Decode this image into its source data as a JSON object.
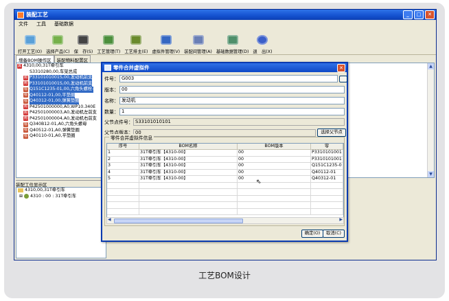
{
  "window": {
    "title": "装配工艺"
  },
  "menu": [
    "文件",
    "工具",
    "基础数据"
  ],
  "toolbar": [
    {
      "label": "打开工艺(O)",
      "icon": "open-process-icon"
    },
    {
      "label": "选择产品(C)",
      "icon": "select-product-icon"
    },
    {
      "label": "保　存(S)",
      "icon": "save-icon"
    },
    {
      "label": "工艺管理(T)",
      "icon": "process-manage-icon"
    },
    {
      "label": "工艺排主(E)",
      "icon": "process-sort-icon"
    },
    {
      "label": "虚拟件管理(V)",
      "icon": "virtual-part-icon"
    },
    {
      "label": "装配间管理(A)",
      "icon": "assembly-room-icon"
    },
    {
      "label": "基础数据管理(D)",
      "icon": "base-data-icon"
    },
    {
      "label": "退　出(X)",
      "icon": "exit-icon"
    }
  ],
  "left_tabs": [
    "增备BOM操作区",
    "装配物料配置区"
  ],
  "tree": [
    {
      "badge": "其",
      "text": "4310,00,31T牵引车",
      "selected": false,
      "indent": 0
    },
    {
      "badge": "",
      "text": "S3310280,00,车架总成",
      "selected": false,
      "indent": 1
    },
    {
      "badge": "购",
      "text": "P3310101001S,00,发动机前支",
      "selected": true,
      "indent": 1
    },
    {
      "badge": "购",
      "text": "P3310101001S,00,发动机前支",
      "selected": true,
      "indent": 1
    },
    {
      "badge": "标",
      "text": "Q151C1235-01,00,六角头螺栓-",
      "selected": true,
      "indent": 1
    },
    {
      "badge": "标",
      "text": "Q40112-01,00,平垫圈",
      "selected": true,
      "indent": 1
    },
    {
      "badge": "标",
      "text": "Q40312-01,00,弹簧垫圈",
      "selected": true,
      "indent": 1
    },
    {
      "badge": "购",
      "text": "P42501000000,A0,WP10.340E",
      "selected": false,
      "indent": 1
    },
    {
      "badge": "购",
      "text": "P42501000003,A0,发动机左前支",
      "selected": false,
      "indent": 1
    },
    {
      "badge": "购",
      "text": "P42501000004,A0,发动机右前支",
      "selected": false,
      "indent": 1
    },
    {
      "badge": "标",
      "text": "Q340B12-01,A0,六角头螺母",
      "selected": false,
      "indent": 1
    },
    {
      "badge": "标",
      "text": "Q40512-01,A0,弹簧垫圈",
      "selected": false,
      "indent": 1
    },
    {
      "badge": "标",
      "text": "Q40110-01,A0,平垫圈",
      "selected": false,
      "indent": 1
    }
  ],
  "lower_panel": {
    "label": "装配工位显示区",
    "items": [
      "4310,00,31T牵引车",
      "4310 : 00 : 31T牵引车"
    ]
  },
  "dialog": {
    "title": "零件合并虚拟件",
    "fields": {
      "part_no_label": "件号：",
      "part_no": "G003",
      "version_label": "版本：",
      "version": "00",
      "name_label": "名称：",
      "name": "发动机",
      "qty_label": "数量：",
      "qty": "1",
      "parent_no_label": "父节点件号：",
      "parent_no": "S33101010101",
      "parent_ver_label": "父节点版本：",
      "parent_ver": "00",
      "select_parent_btn": "选择父节点"
    },
    "group_label": "零件合并虚拟件信息",
    "table": {
      "headers": [
        "序号",
        "BOM名称",
        "BOM版本",
        "零"
      ],
      "rows": [
        [
          "1",
          "31T牵引车【4310-00】",
          "00",
          "P3310101001"
        ],
        [
          "2",
          "31T牵引车【4310-00】",
          "00",
          "P3310101001"
        ],
        [
          "3",
          "31T牵引车【4310-00】",
          "00",
          "Q151C1235-0"
        ],
        [
          "4",
          "31T牵引车【4310-00】",
          "00",
          "Q40112-01"
        ],
        [
          "5",
          "31T牵引车【4310-00】",
          "00",
          "Q40312-01"
        ]
      ]
    },
    "ok_button": "确定(O)",
    "cancel_button": "取消(C)"
  },
  "caption": "工艺BOM设计",
  "colors": {
    "title_blue": "#1451cf",
    "selection": "#316ac5",
    "window_bg": "#ece9d8"
  }
}
